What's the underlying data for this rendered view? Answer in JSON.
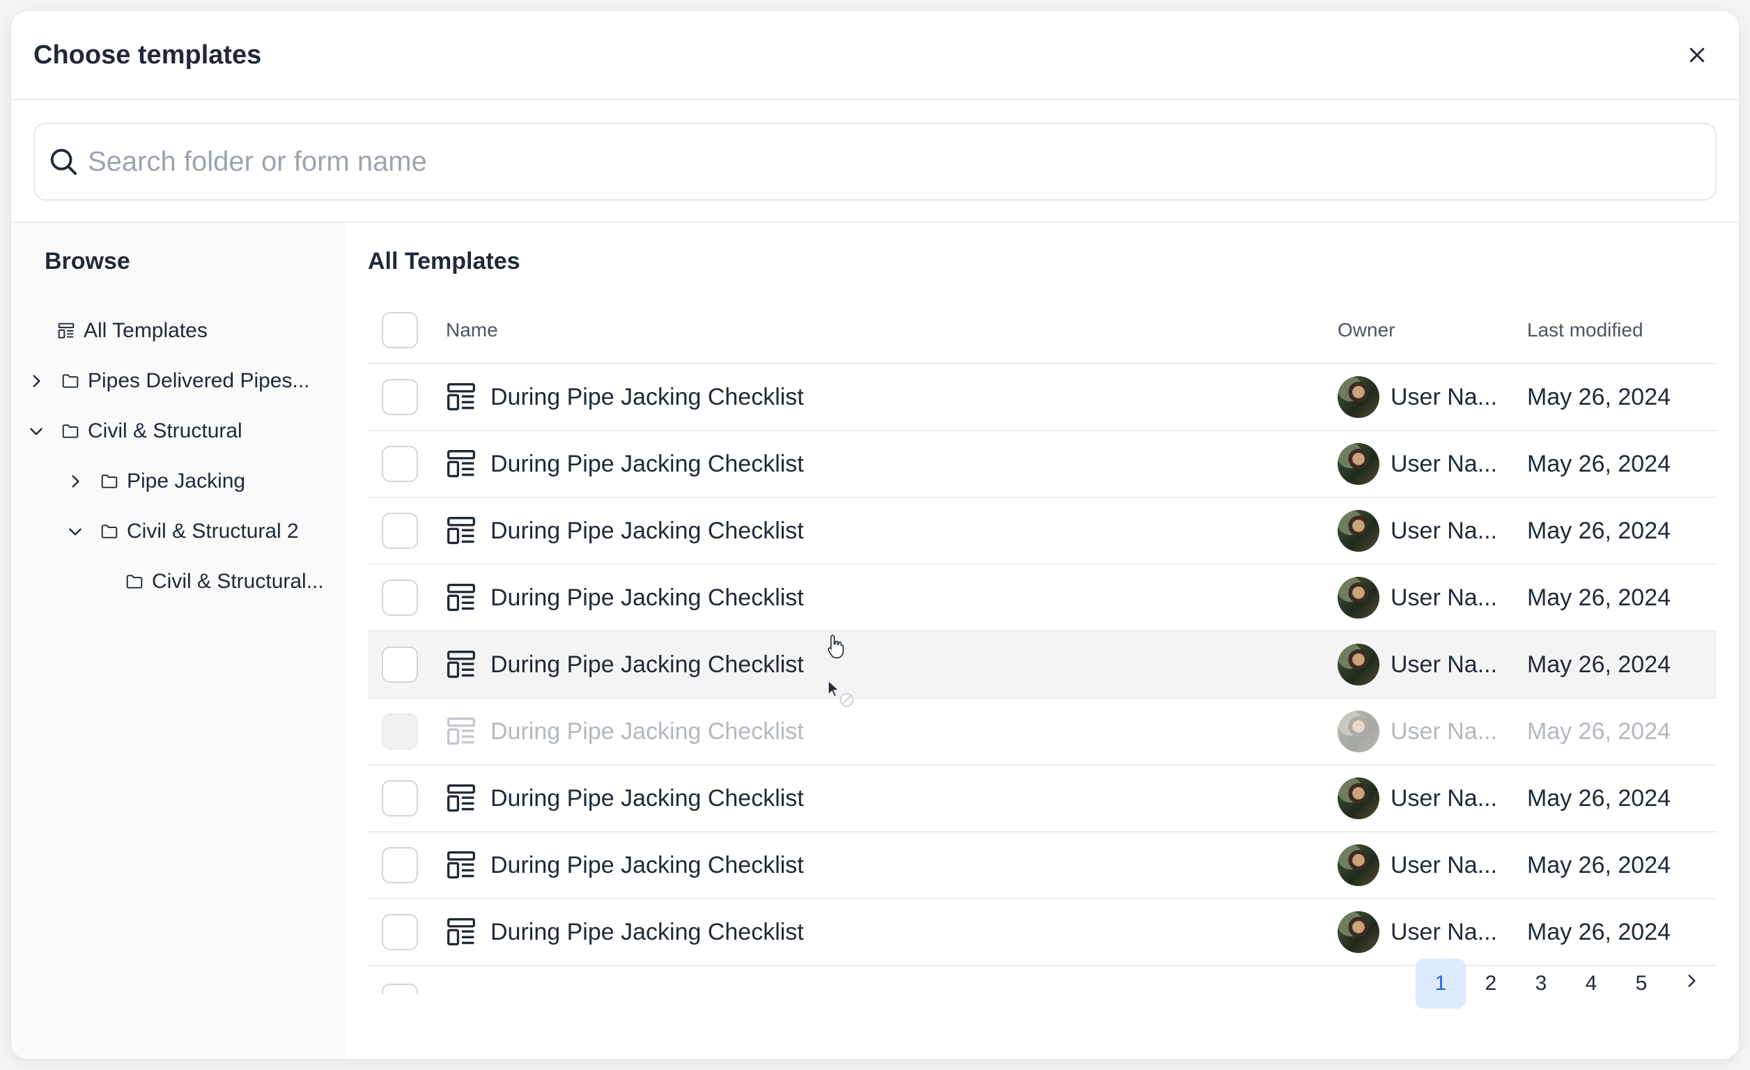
{
  "modal": {
    "title": "Choose templates",
    "close_icon": "close-icon"
  },
  "search": {
    "placeholder": "Search folder or form name",
    "icon": "search-icon"
  },
  "sidebar": {
    "title": "Browse",
    "items": [
      {
        "label": "All Templates",
        "icon": "template-icon",
        "chevron": "none"
      },
      {
        "label": "Pipes Delivered Pipes...",
        "icon": "folder-icon",
        "chevron": "right"
      },
      {
        "label": "Civil & Structural",
        "icon": "folder-icon",
        "chevron": "down"
      },
      {
        "label": "Pipe Jacking",
        "icon": "folder-icon",
        "chevron": "right"
      },
      {
        "label": "Civil & Structural 2",
        "icon": "folder-icon",
        "chevron": "down"
      },
      {
        "label": "Civil & Structural...",
        "icon": "folder-icon",
        "chevron": "none"
      }
    ]
  },
  "main": {
    "title": "All Templates",
    "columns": {
      "name": "Name",
      "owner": "Owner",
      "modified": "Last modified"
    },
    "rows": [
      {
        "name": "During Pipe Jacking Checklist",
        "owner": "User Na...",
        "modified": "May 26, 2024",
        "state": "normal"
      },
      {
        "name": "During Pipe Jacking Checklist",
        "owner": "User Na...",
        "modified": "May 26, 2024",
        "state": "normal"
      },
      {
        "name": "During Pipe Jacking Checklist",
        "owner": "User Na...",
        "modified": "May 26, 2024",
        "state": "normal"
      },
      {
        "name": "During Pipe Jacking Checklist",
        "owner": "User Na...",
        "modified": "May 26, 2024",
        "state": "normal"
      },
      {
        "name": "During Pipe Jacking Checklist",
        "owner": "User Na...",
        "modified": "May 26, 2024",
        "state": "hover"
      },
      {
        "name": "During Pipe Jacking Checklist",
        "owner": "User Na...",
        "modified": "May 26, 2024",
        "state": "disabled"
      },
      {
        "name": "During Pipe Jacking Checklist",
        "owner": "User Na...",
        "modified": "May 26, 2024",
        "state": "normal"
      },
      {
        "name": "During Pipe Jacking Checklist",
        "owner": "User Na...",
        "modified": "May 26, 2024",
        "state": "normal"
      },
      {
        "name": "During Pipe Jacking Checklist",
        "owner": "User Na...",
        "modified": "May 26, 2024",
        "state": "normal"
      }
    ]
  },
  "pagination": {
    "pages": [
      "1",
      "2",
      "3",
      "4",
      "5"
    ],
    "current": "1",
    "next_icon": "chevron-right-icon"
  },
  "colors": {
    "accent": "#2563eb",
    "accent_bg": "#dbeafe",
    "text": "#1f2937",
    "muted": "#9ca3af",
    "border": "#ececec"
  }
}
